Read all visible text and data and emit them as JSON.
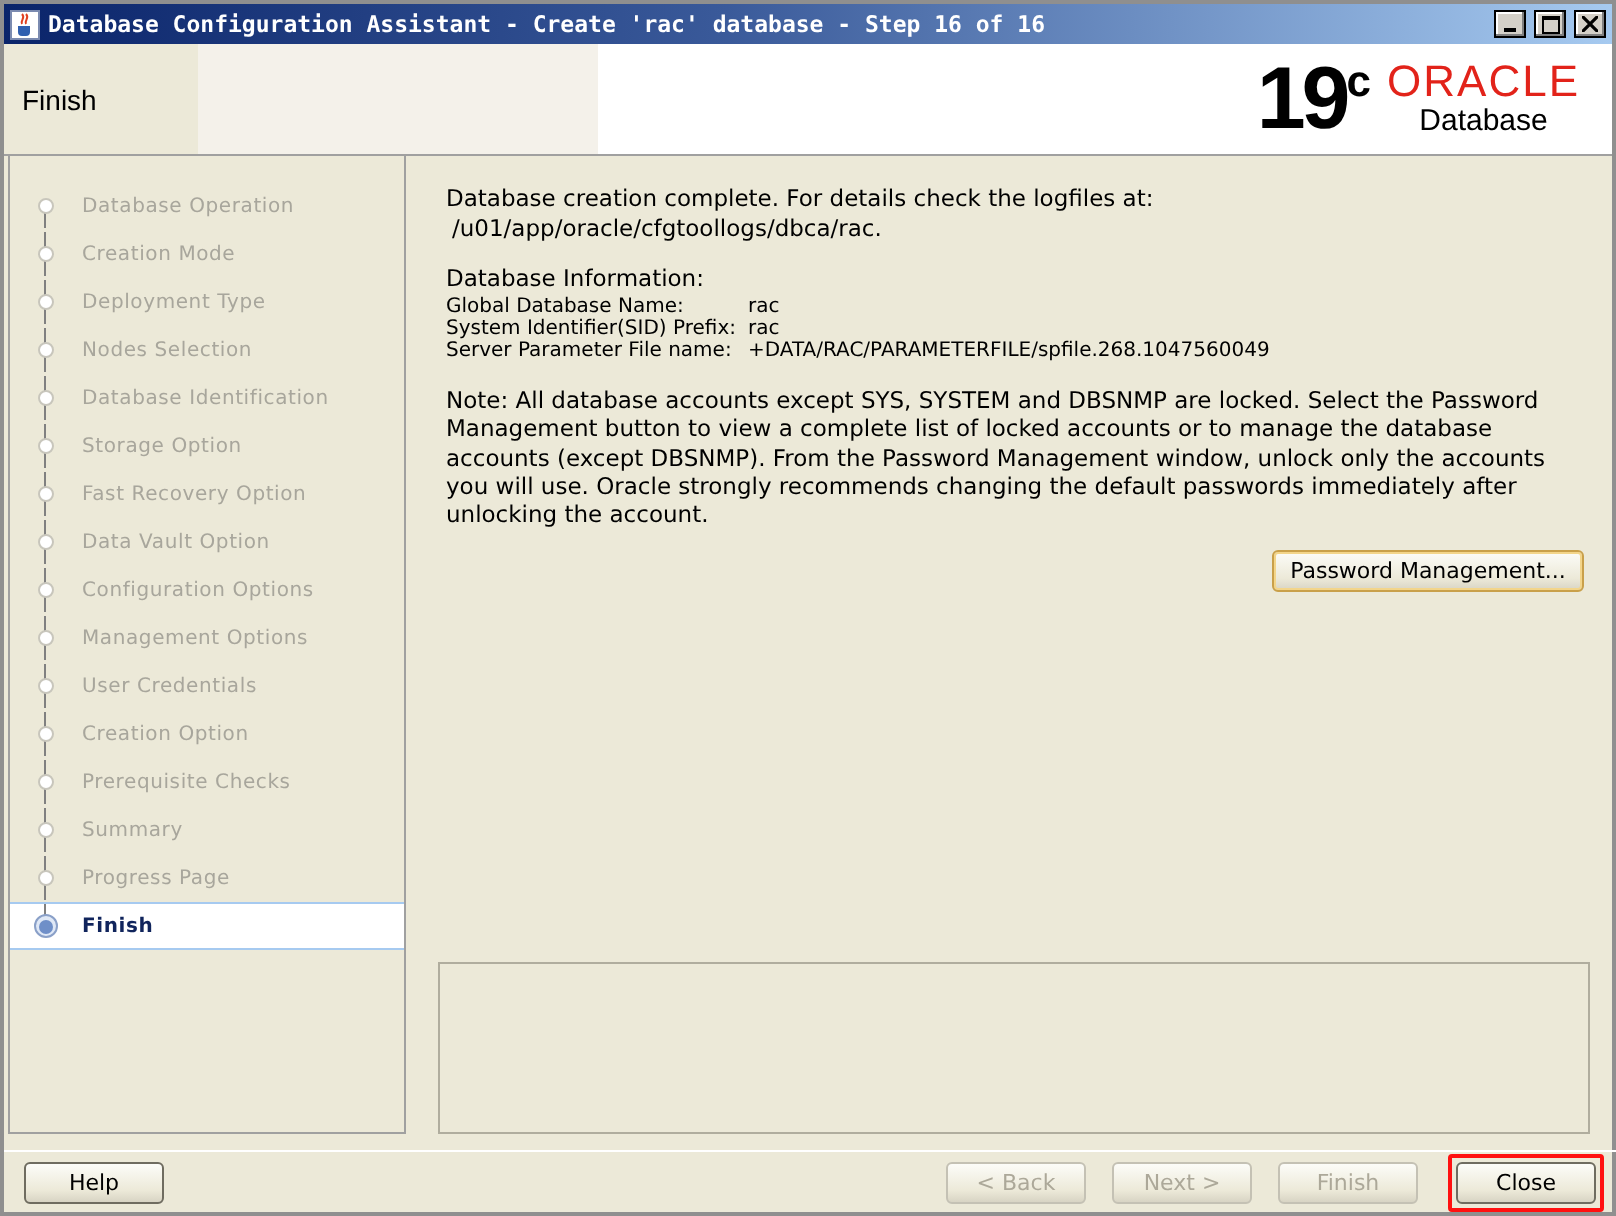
{
  "window": {
    "title": "Database Configuration Assistant - Create 'rac' database - Step 16 of 16",
    "controls": [
      {
        "kind": "minimize"
      },
      {
        "kind": "maximize"
      },
      {
        "kind": "close"
      }
    ]
  },
  "header": {
    "title": "Finish",
    "logo": {
      "version": "19",
      "superscript": "c",
      "brand": "ORACLE",
      "product": "Database"
    }
  },
  "steps": [
    {
      "label": "Database Operation",
      "selected": false
    },
    {
      "label": "Creation Mode",
      "selected": false
    },
    {
      "label": "Deployment Type",
      "selected": false
    },
    {
      "label": "Nodes Selection",
      "selected": false
    },
    {
      "label": "Database Identification",
      "selected": false
    },
    {
      "label": "Storage Option",
      "selected": false
    },
    {
      "label": "Fast Recovery Option",
      "selected": false
    },
    {
      "label": "Data Vault Option",
      "selected": false
    },
    {
      "label": "Configuration Options",
      "selected": false
    },
    {
      "label": "Management Options",
      "selected": false
    },
    {
      "label": "User Credentials",
      "selected": false
    },
    {
      "label": "Creation Option",
      "selected": false
    },
    {
      "label": "Prerequisite Checks",
      "selected": false
    },
    {
      "label": "Summary",
      "selected": false
    },
    {
      "label": "Progress Page",
      "selected": false
    },
    {
      "label": "Finish",
      "selected": true
    }
  ],
  "content": {
    "message": "Database creation complete. For details check the logfiles at:",
    "log_path": "/u01/app/oracle/cfgtoollogs/dbca/rac.",
    "info_heading": "Database Information:",
    "info": [
      {
        "label": "Global Database Name:",
        "value": "rac"
      },
      {
        "label": "System Identifier(SID) Prefix:",
        "value": "rac"
      },
      {
        "label": "Server Parameter File name:",
        "value": "+DATA/RAC/PARAMETERFILE/spfile.268.1047560049"
      }
    ],
    "note": "Note: All database accounts except SYS, SYSTEM and DBSNMP are locked. Select the Password Management button to view a complete list of locked accounts or to manage the database accounts (except DBSNMP). From the Password Management window, unlock only the accounts you will use. Oracle strongly recommends changing the default passwords immediately after unlocking the account.",
    "password_button": "Password Management..."
  },
  "footer": {
    "help": "Help",
    "buttons": [
      {
        "label": "< Back",
        "disabled": true,
        "highlighted": false
      },
      {
        "label": "Next >",
        "disabled": true,
        "highlighted": false
      },
      {
        "label": "Finish",
        "disabled": true,
        "highlighted": false
      },
      {
        "label": "Close",
        "disabled": false,
        "highlighted": true
      }
    ]
  }
}
